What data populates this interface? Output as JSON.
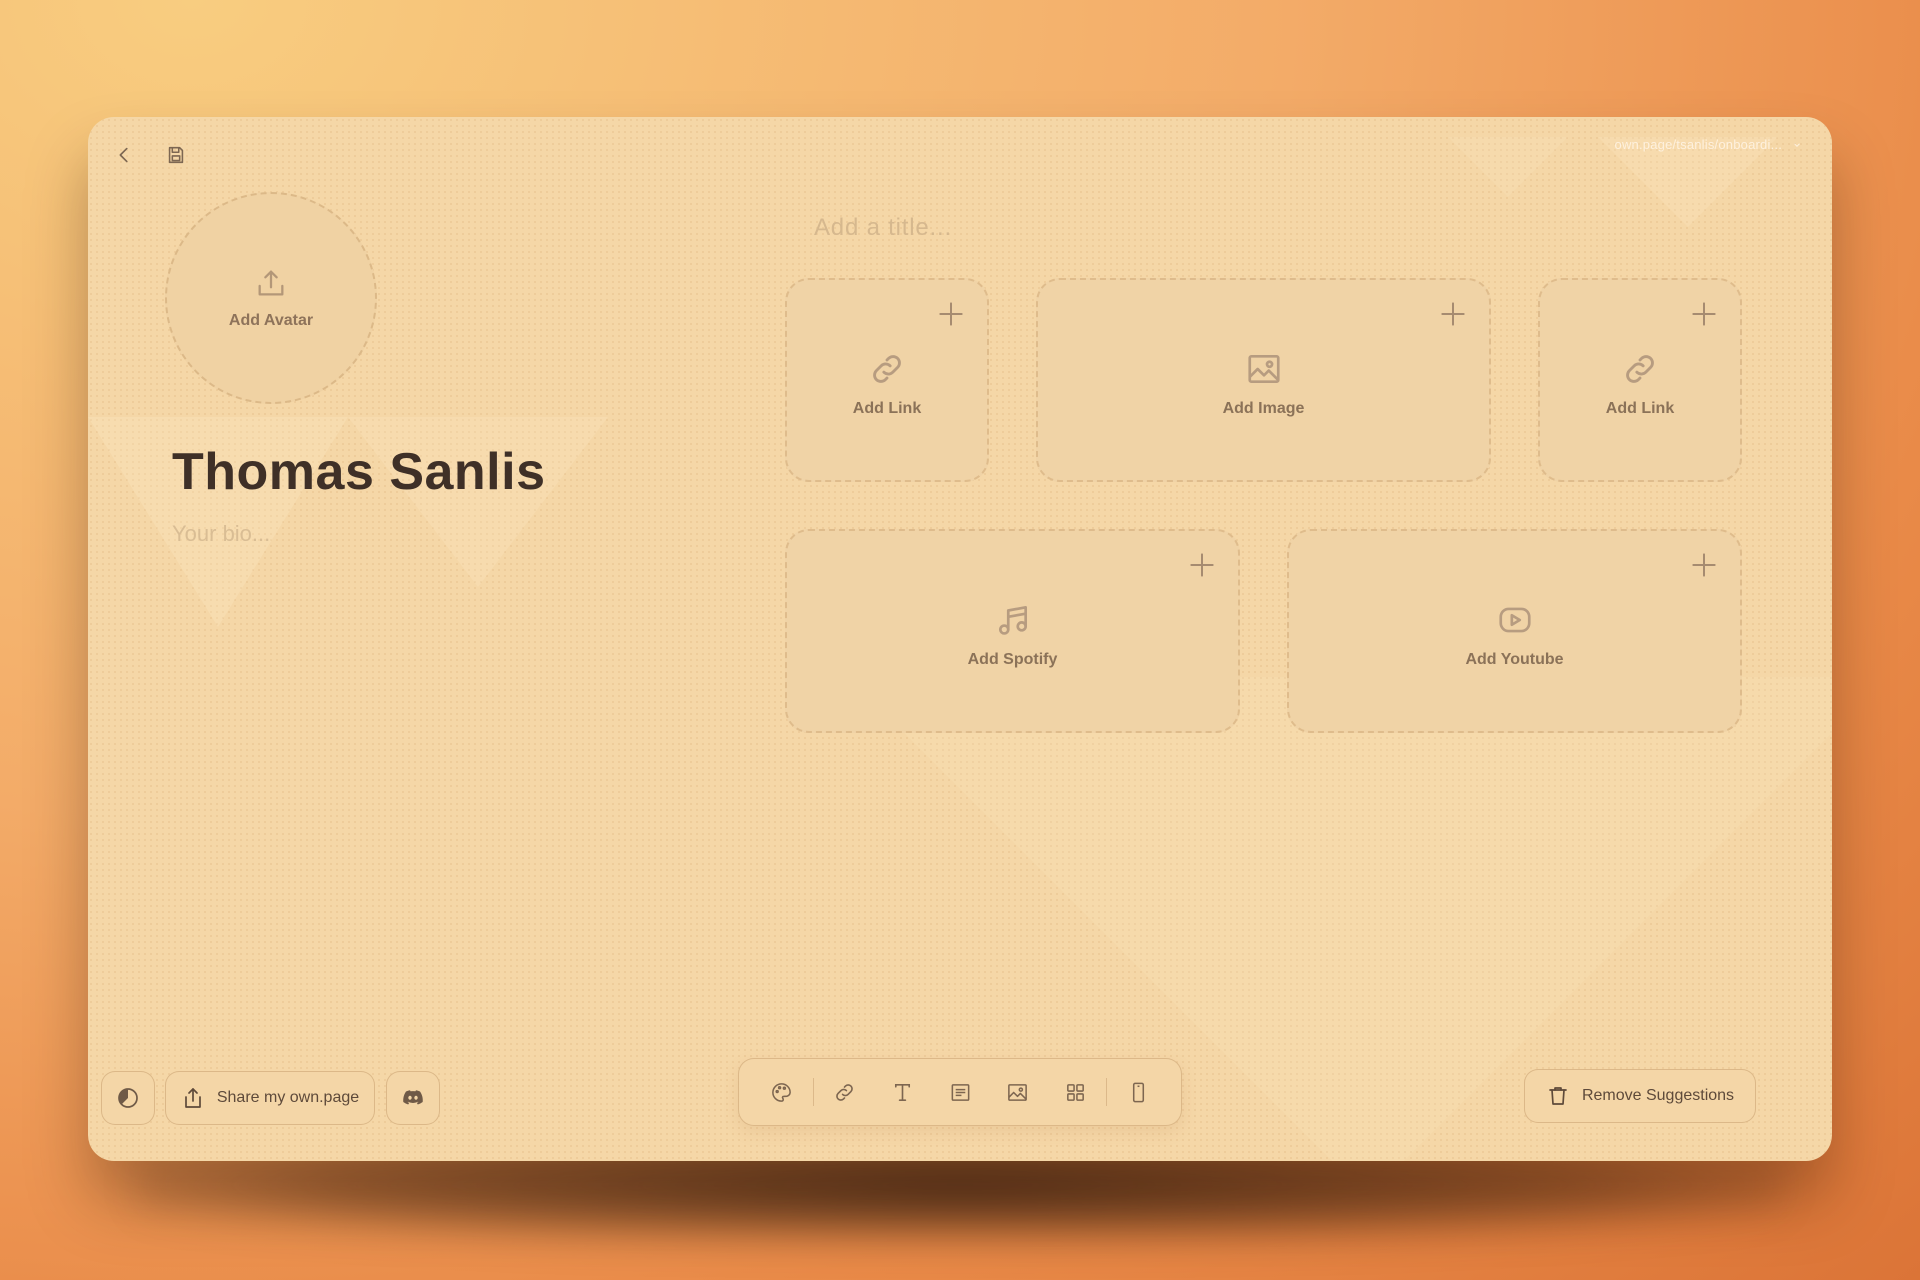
{
  "header": {
    "url": "own.page/tsanlis/onboardi...",
    "back_icon": "chevron-left-icon",
    "save_icon": "save-icon"
  },
  "profile": {
    "avatar_label": "Add Avatar",
    "name": "Thomas Sanlis",
    "bio_placeholder": "Your bio..."
  },
  "main": {
    "title_placeholder": "Add a title...",
    "cards": [
      {
        "label": "Add Link",
        "icon": "link-icon"
      },
      {
        "label": "Add Image",
        "icon": "image-icon"
      },
      {
        "label": "Add Link",
        "icon": "link-icon"
      },
      {
        "label": "Add Spotify",
        "icon": "music-icon"
      },
      {
        "label": "Add Youtube",
        "icon": "youtube-icon"
      }
    ]
  },
  "footer": {
    "share_label": "Share my own.page",
    "remove_label": "Remove Suggestions",
    "toolbar_icons": [
      "palette-icon",
      "link-icon",
      "text-icon",
      "paragraph-icon",
      "image-icon",
      "grid-icon",
      "mobile-icon"
    ]
  },
  "colors": {
    "background": "#f5d7a7",
    "text_dark": "#3f3027",
    "muted": "#8b7258"
  }
}
